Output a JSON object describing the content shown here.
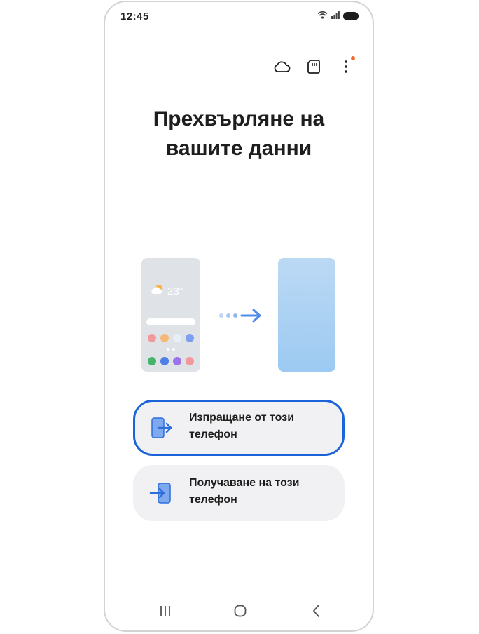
{
  "status_bar": {
    "time": "12:45",
    "icons": [
      "wifi-icon",
      "signal-icon",
      "battery-icon"
    ]
  },
  "toolbar": {
    "items": [
      "cloud-icon",
      "sd-card-icon",
      "more-options-icon"
    ],
    "notification_dot_color": "#f36a2d"
  },
  "title": {
    "line1": "Прехвърляне на",
    "line2": "вашите данни"
  },
  "illustration": {
    "weather_temp": "23°"
  },
  "actions": [
    {
      "label": "Изпращане от този телефон",
      "icon": "send-from-phone-icon",
      "selected": true
    },
    {
      "label": "Получаване на този телефон",
      "icon": "receive-to-phone-icon",
      "selected": false
    }
  ],
  "nav_bar": {
    "items": [
      "recent-apps-icon",
      "home-icon",
      "back-icon"
    ]
  },
  "colors": {
    "accent": "#1a63d8",
    "button_bg": "#f1f1f3",
    "new_phone": "#9ccaf2"
  }
}
